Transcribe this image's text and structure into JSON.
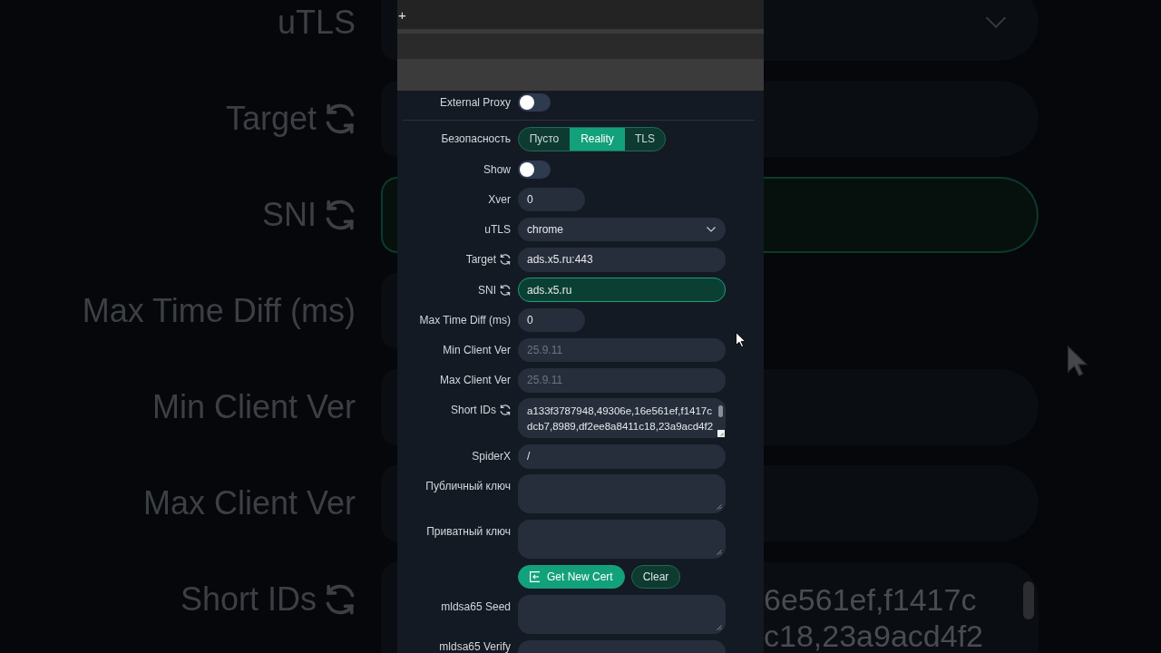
{
  "backdrop": {
    "rows": [
      {
        "kind": "select",
        "label": "uTLS",
        "refresh_icon": false,
        "focused": false
      },
      {
        "kind": "input",
        "label": "Target",
        "refresh_icon": true,
        "focused": false
      },
      {
        "kind": "input",
        "label": "SNI",
        "refresh_icon": true,
        "focused": true
      },
      {
        "kind": "number",
        "label": "Max Time Diff (ms)",
        "refresh_icon": false,
        "focused": false
      },
      {
        "kind": "input",
        "label": "Min Client Ver",
        "refresh_icon": false,
        "focused": false
      },
      {
        "kind": "input",
        "label": "Max Client Ver",
        "refresh_icon": false,
        "focused": false
      },
      {
        "kind": "textarea",
        "label": "Short IDs",
        "refresh_icon": true,
        "focused": false,
        "value_lines": [
          "6e561ef,f1417c",
          "c18,23a9acd4f2"
        ]
      }
    ]
  },
  "header": {
    "symbol": "+"
  },
  "external_proxy": {
    "label": "External Proxy",
    "on": false
  },
  "form": {
    "rows": [
      {
        "kind": "segmented",
        "label": "Безопасность",
        "refresh_icon": false,
        "options": [
          {
            "label": "Пусто",
            "selected": false
          },
          {
            "label": "Reality",
            "selected": true
          },
          {
            "label": "TLS",
            "selected": false
          }
        ]
      },
      {
        "kind": "toggle",
        "label": "Show",
        "refresh_icon": false,
        "on": false
      },
      {
        "kind": "number",
        "label": "Xver",
        "refresh_icon": false,
        "focused": false,
        "value": "0"
      },
      {
        "kind": "select",
        "label": "uTLS",
        "refresh_icon": false,
        "focused": false,
        "value": "chrome"
      },
      {
        "kind": "input",
        "label": "Target",
        "refresh_icon": true,
        "focused": false,
        "value": "ads.x5.ru:443"
      },
      {
        "kind": "input",
        "label": "SNI",
        "refresh_icon": true,
        "focused": true,
        "value": "ads.x5.ru"
      },
      {
        "kind": "number",
        "label": "Max Time Diff (ms)",
        "refresh_icon": false,
        "focused": false,
        "value": "0"
      },
      {
        "kind": "input",
        "label": "Min Client Ver",
        "refresh_icon": false,
        "focused": false,
        "placeholder": "25.9.11"
      },
      {
        "kind": "input",
        "label": "Max Client Ver",
        "refresh_icon": false,
        "focused": false,
        "placeholder": "25.9.11"
      },
      {
        "kind": "textarea",
        "label": "Short IDs",
        "refresh_icon": true,
        "focused": false,
        "value_lines": [
          "a133f3787948,49306e,16e561ef,f1417c",
          "dcb7,8989,df2ee8a8411c18,23a9acd4f2"
        ]
      },
      {
        "kind": "input",
        "label": "SpiderX",
        "refresh_icon": false,
        "focused": false,
        "value": "/"
      },
      {
        "kind": "textarea",
        "label": "Публичный ключ",
        "refresh_icon": false,
        "focused": false
      },
      {
        "kind": "textarea",
        "label": "Приватный ключ",
        "refresh_icon": false,
        "focused": false
      },
      {
        "kind": "buttons",
        "buttons": [
          {
            "label": "Get New Cert",
            "kind": "primary"
          },
          {
            "label": "Clear",
            "kind": "secondary"
          }
        ]
      },
      {
        "kind": "textarea",
        "label": "mldsa65 Seed",
        "refresh_icon": false,
        "focused": false
      },
      {
        "kind": "textarea",
        "label": "mldsa65 Verify",
        "refresh_icon": false,
        "focused": false
      }
    ]
  }
}
